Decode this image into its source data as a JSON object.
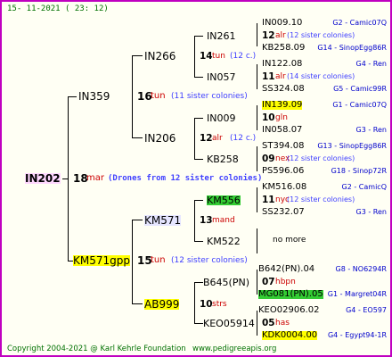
{
  "header": {
    "date": "15- 11-2021 ( 23: 12)"
  },
  "footer": {
    "copyright": "Copyright 2004-2021 @ Karl Kehrle Foundation",
    "site": "www.pedigreeapis.org"
  },
  "root": {
    "name": "IN202",
    "num": "18",
    "gen": "mar",
    "note": "(Drones from 12 sister colonies)"
  },
  "gen1": {
    "top": {
      "name": "IN359",
      "num": "16",
      "gen": "tun",
      "note": "(11 sister colonies)"
    },
    "bottom": {
      "name": "KM571gpp",
      "num": "15",
      "gen": "tun",
      "note": "(12 sister colonies)"
    }
  },
  "gen2": {
    "a": {
      "name": "IN266",
      "num": "14",
      "gen": "tun",
      "note": "(12 c.)"
    },
    "b": {
      "name": "IN206",
      "num": "12",
      "gen": "alr",
      "note": "(12 c.)"
    },
    "c": {
      "name": "KM571",
      "num": "13",
      "gen": "mand",
      "note": ""
    },
    "d": {
      "name": "AB999",
      "num": "10",
      "gen": "strs",
      "note": ""
    }
  },
  "gen3": {
    "a1": {
      "name": "IN261",
      "num": "12",
      "gen": "alr",
      "note": "(12 sister colonies)"
    },
    "a2": {
      "name": "IN057",
      "num": "11",
      "gen": "alr",
      "note": "(14 sister colonies)"
    },
    "b1": {
      "name": "IN009",
      "num": "10",
      "gen": "gln",
      "note": ""
    },
    "b2": {
      "name": "KB258",
      "num": "09",
      "gen": "nex",
      "note": "(12 sister colonies)"
    },
    "c1": {
      "name": "KM556",
      "num": "11",
      "gen": "nyc",
      "note": "(12 sister colonies)"
    },
    "c2": {
      "name": "KM522",
      "num": "",
      "gen": "",
      "note": ""
    },
    "d1": {
      "name": "B645(PN)",
      "num": "07",
      "gen": "hbpn",
      "note": ""
    },
    "d2": {
      "name": "KEO05914",
      "num": "05",
      "gen": "has",
      "note": ""
    }
  },
  "gen4": [
    {
      "name": "IN009.10",
      "right": "G2 - Camic07Q"
    },
    {
      "name": "KB258.09",
      "right": "G14 - SinopEgg86R"
    },
    {
      "name": "IN122.08",
      "right": "G4 - Ren"
    },
    {
      "name": "SS324.08",
      "right": "G5 - Camic99R"
    },
    {
      "name": "IN139.09",
      "right": "G1 - Camic07Q"
    },
    {
      "name": "IN058.07",
      "right": "G3 - Ren"
    },
    {
      "name": "ST394.08",
      "right": "G13 - SinopEgg86R"
    },
    {
      "name": "PS596.06",
      "right": "G18 - Sinop72R"
    },
    {
      "name": "KM516.08",
      "right": "G2 - CamicQ"
    },
    {
      "name": "SS232.07",
      "right": "G3 - Ren"
    },
    {
      "name": "no more",
      "right": ""
    },
    {
      "name": "B642(PN).04",
      "right": "G8 - NO6294R"
    },
    {
      "name": "MG081(PN).05",
      "right": "G1 - Margret04R"
    },
    {
      "name": "KEO02906.02",
      "right": "G4 - EO597"
    },
    {
      "name": "KDK0004.00",
      "right": "G4 - Egypt94-1R"
    }
  ]
}
